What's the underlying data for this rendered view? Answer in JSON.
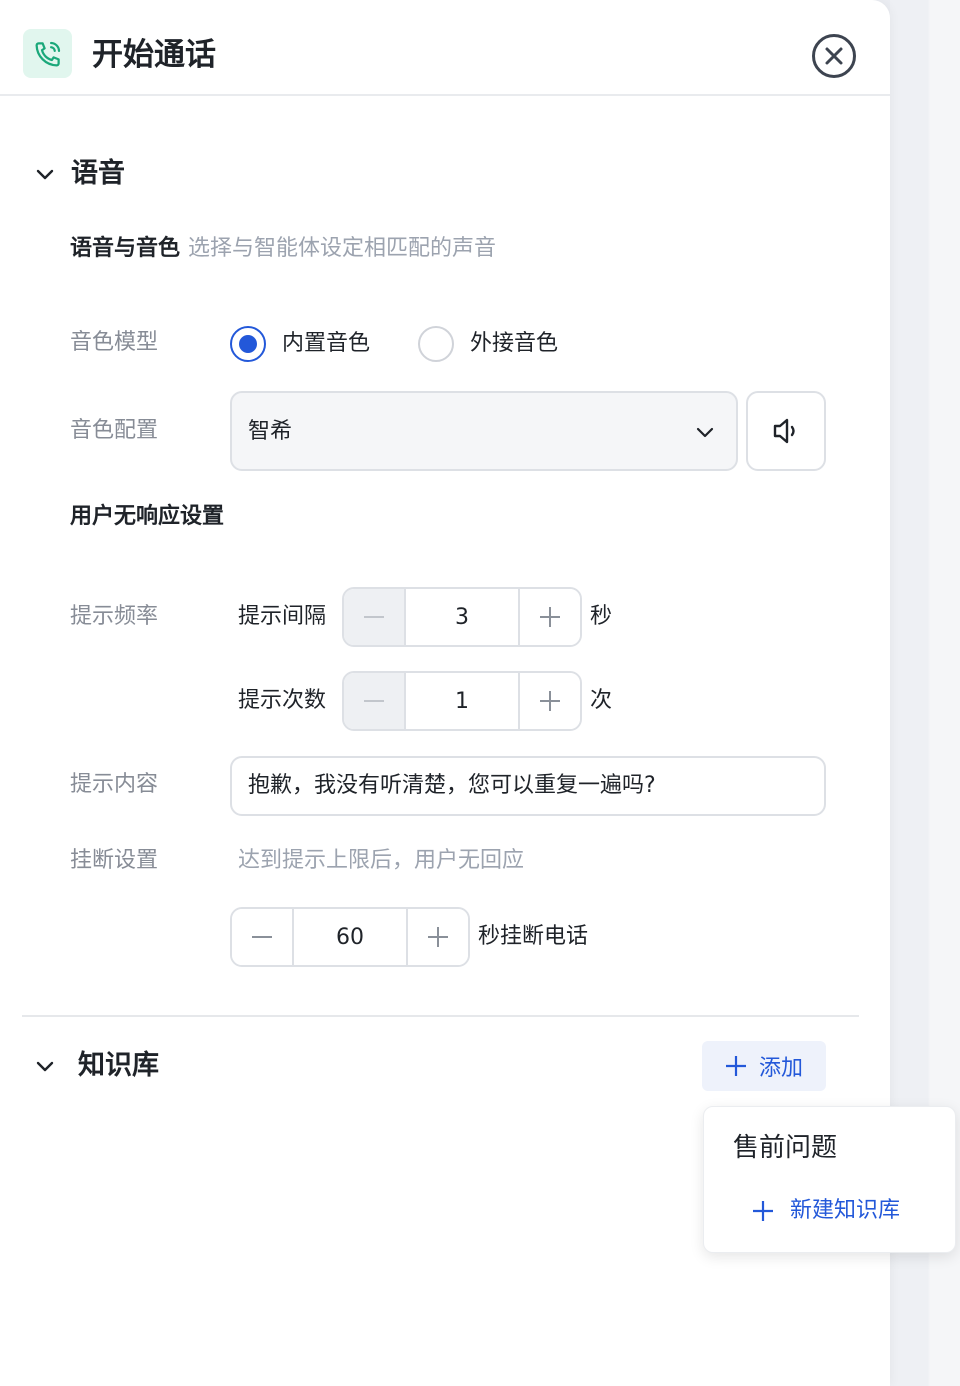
{
  "header": {
    "title": "开始通话"
  },
  "voice_section": {
    "title": "语音",
    "voice_tone_label": "语音与音色",
    "voice_tone_hint": "选择与智能体设定相匹配的声音",
    "model_label": "音色模型",
    "model_options": [
      {
        "label": "内置音色",
        "selected": true
      },
      {
        "label": "外接音色",
        "selected": false
      }
    ],
    "config_label": "音色配置",
    "config_value": "智希",
    "no_response_title": "用户无响应设置",
    "frequency_label": "提示频率",
    "interval_label": "提示间隔",
    "interval_value": "3",
    "interval_unit": "秒",
    "count_label": "提示次数",
    "count_value": "1",
    "count_unit": "次",
    "content_label": "提示内容",
    "content_value": "抱歉，我没有听清楚，您可以重复一遍吗?",
    "hangup_label": "挂断设置",
    "hangup_hint": "达到提示上限后，用户无回应",
    "hangup_value": "60",
    "hangup_unit": "秒挂断电话"
  },
  "knowledge_section": {
    "title": "知识库",
    "add_label": "添加",
    "dropdown": {
      "items": [
        "售前问题"
      ],
      "new_label": "新建知识库"
    }
  },
  "colors": {
    "accent": "#2358d9",
    "phone_icon": "#1aa87a",
    "header_icon_bg": "#e1f6ee"
  }
}
